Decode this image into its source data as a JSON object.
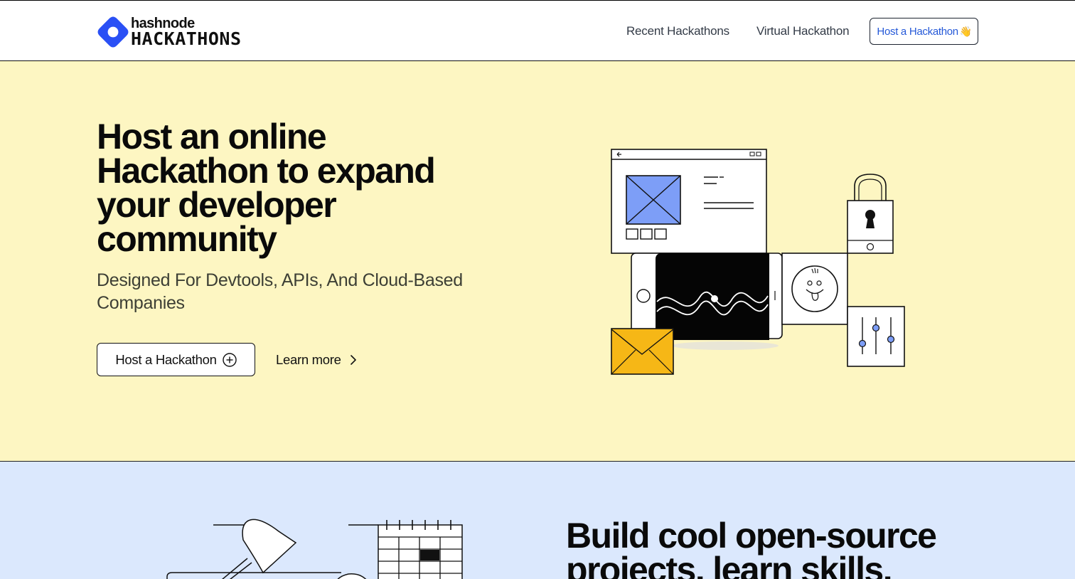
{
  "header": {
    "logo_small": "hashnode",
    "logo_big": "HACKATHONS",
    "nav": [
      {
        "label": "Recent Hackathons"
      },
      {
        "label": "Virtual Hackathon"
      }
    ],
    "cta_label": "Host a Hackathon",
    "cta_emoji": "👋",
    "brand_color": "#2a50f5"
  },
  "hero": {
    "title_lines": [
      "Host an online",
      "Hackathon to expand",
      "your developer",
      "community"
    ],
    "subtitle_lines": [
      "Designed For Devtools, APIs, And Cloud-Based",
      "Companies"
    ],
    "primary_button": "Host a Hackathon",
    "secondary_button": "Learn more",
    "background": "#fdf6c2"
  },
  "section2": {
    "title_lines": [
      "Build cool open-source",
      "projects, learn skills,"
    ],
    "background": "#dbe8fd"
  }
}
